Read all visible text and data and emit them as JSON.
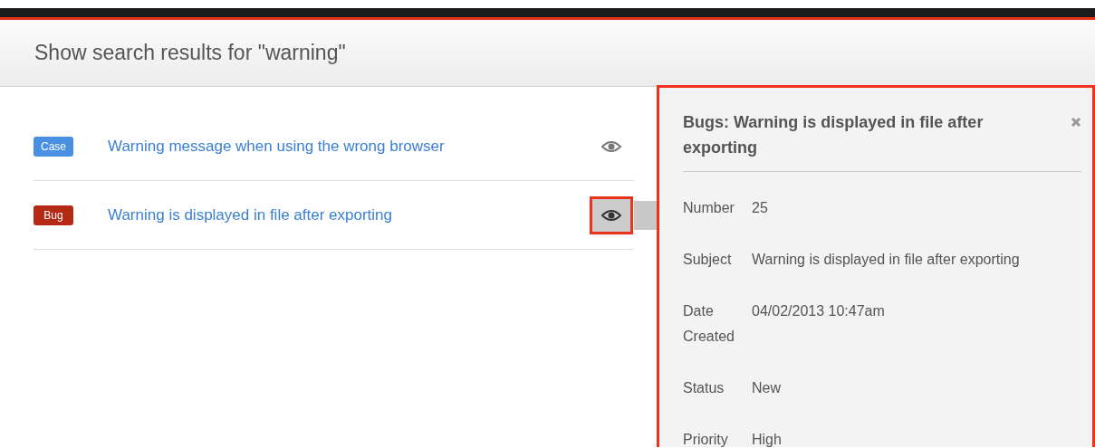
{
  "header": {
    "title": "Show search results for \"warning\""
  },
  "results": [
    {
      "tag": "Case",
      "color": "#4a90e2",
      "title": "Warning message when using the wrong browser",
      "selected": false
    },
    {
      "tag": "Bug",
      "color": "#b52a15",
      "title": "Warning is displayed in file after exporting",
      "selected": true
    }
  ],
  "preview": {
    "title": "Bugs: Warning is displayed in file after exporting",
    "fields": [
      {
        "label": "Number",
        "value": "25"
      },
      {
        "label": "Subject",
        "value": "Warning is displayed in file after exporting"
      },
      {
        "label": "Date Created",
        "value": "04/02/2013 10:47am"
      },
      {
        "label": "Status",
        "value": "New"
      },
      {
        "label": "Priority",
        "value": "High"
      }
    ]
  }
}
